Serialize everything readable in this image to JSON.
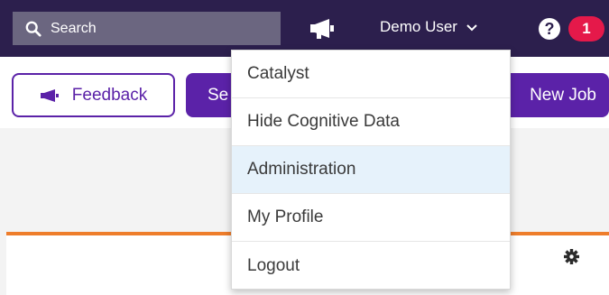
{
  "search": {
    "placeholder": "Search"
  },
  "header": {
    "user_name": "Demo User",
    "help_label": "?",
    "notification_count": "1"
  },
  "toolbar": {
    "feedback_label": "Feedback",
    "partial_button_label": "Se",
    "new_job_label": "New Job"
  },
  "user_menu": {
    "items": [
      {
        "label": "Catalyst"
      },
      {
        "label": "Hide Cognitive Data"
      },
      {
        "label": "Administration",
        "highlighted": true
      },
      {
        "label": "My Profile"
      },
      {
        "label": "Logout"
      }
    ]
  },
  "colors": {
    "topbar": "#2c1f4d",
    "brand_purple": "#5b22a8",
    "badge_red": "#e5194a",
    "accent_orange": "#ee7d2b",
    "menu_highlight": "#e6f2fb"
  },
  "icons": [
    "search-icon",
    "megaphone-icon",
    "chevron-down-icon",
    "help-icon",
    "gear-icon"
  ]
}
